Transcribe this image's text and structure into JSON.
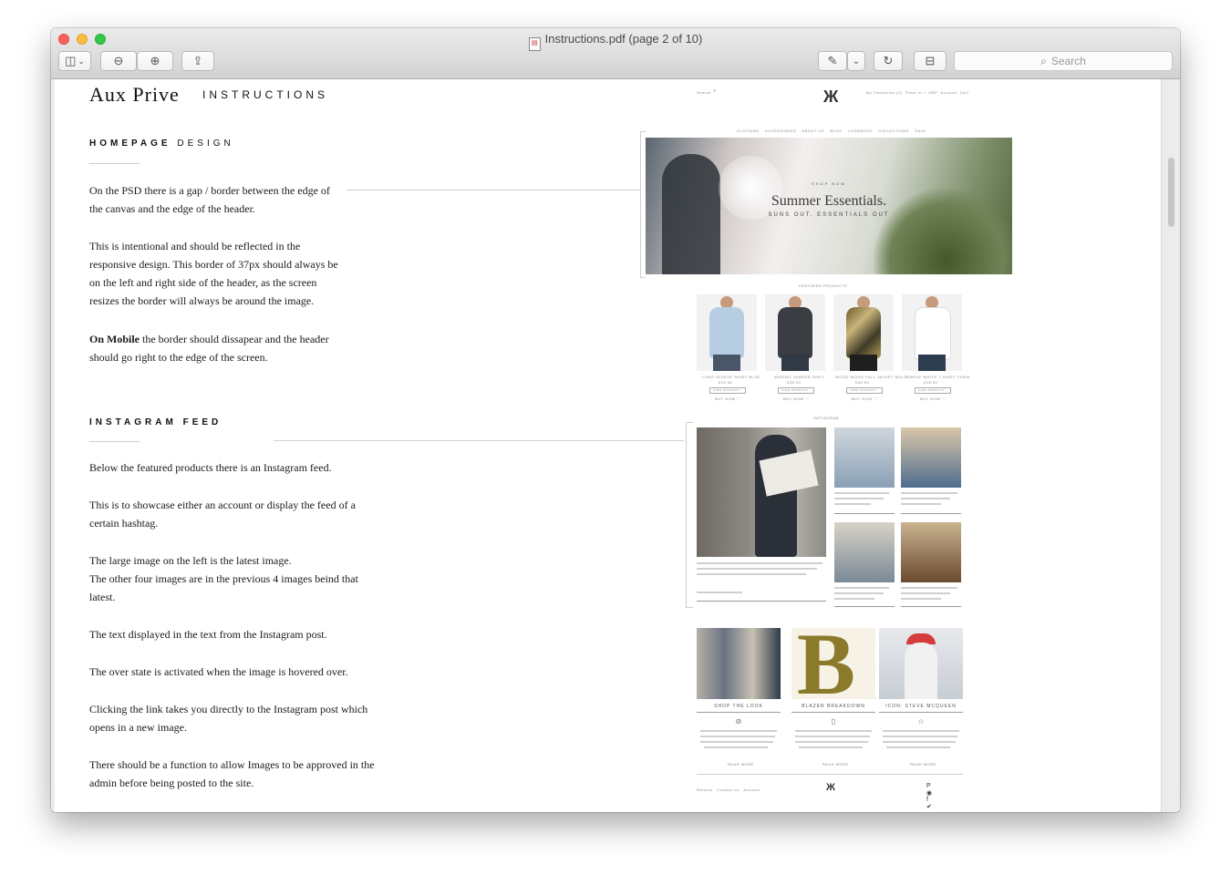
{
  "window": {
    "title": "Instructions.pdf (page 2 of 10)",
    "search_placeholder": "Search"
  },
  "toolbar": {
    "icons": [
      "sidebar-icon",
      "zoom-out-icon",
      "zoom-in-icon",
      "share-icon",
      "markup-icon",
      "rotate-icon",
      "toolbox-icon"
    ]
  },
  "document": {
    "brand": "Aux Prive",
    "header_title": "INSTRUCTIONS",
    "sections": {
      "homepage": {
        "heading_bold": "HOMEPAGE",
        "heading_rest": "DESIGN",
        "p1": "On the PSD there is a gap / border between the edge of the canvas and the edge of the header.",
        "p2": "This is intentional and should be reflected in the responsive design. This border of 37px should always be on the left and right side of the header, as the screen resizes the border will always be around the image.",
        "p3_bold": "On Mobile",
        "p3_rest": " the border should dissapear and the header should go right to the edge of the screen."
      },
      "instagram": {
        "heading": "INSTAGRAM FEED",
        "p1": "Below the featured products there is an Instagram feed.",
        "p2": "This is to showcase either an account or display the feed of a certain hashtag.",
        "p3a": "The large image on the left is the latest image.",
        "p3b": "The other four images are in the previous 4 images beind that latest.",
        "p4": "The text displayed in the text from the Instagram post.",
        "p5": "The over state is activated when the image is hovered over.",
        "p6": "Clicking the link takes you directly to the Instagram post which opens in a new image.",
        "p7": "There should be a function to allow Images to be approved in the admin before being posted to the site."
      }
    }
  },
  "mockup": {
    "nav_left": "Search",
    "nav_right": [
      "My Favourites (1)",
      "Place in ☆ GBP",
      "Account",
      "Cart"
    ],
    "menu": [
      "CLOTHING",
      "ACCESSORIES",
      "ABOUT US",
      "BLOG",
      "LOOKBOOK",
      "COLLECTIONS",
      "SALE"
    ],
    "hero_kicker": "SHOP NOW",
    "hero_title": "Summer Essentials.",
    "hero_sub": "SUNS OUT. ESSENTIALS OUT",
    "featured_heading": "FEATURED PRODUCTS",
    "products": [
      {
        "name": "LONG SLEEVE SHIRT BLUE",
        "price": "£29.00",
        "button": "VIEW PRODUCT",
        "fav": "BUY NOW ♡"
      },
      {
        "name": "MERINO JUMPER GREY",
        "price": "£35.00",
        "button": "VIEW PRODUCT",
        "fav": "BUY NOW ♡"
      },
      {
        "name": "WOOD WOOD FALL JACKET MULTI",
        "price": "£89.00",
        "button": "VIEW PRODUCT",
        "fav": "BUY NOW ♡"
      },
      {
        "name": "SIMPLE WHITE T-SHIRT CREW",
        "price": "£15.00",
        "button": "VIEW PRODUCT",
        "fav": "BUY NOW ♡"
      }
    ],
    "instagram_heading": "INSTAGRAM",
    "blog_posts": [
      {
        "title": "SHOP THE LOOK",
        "icon": "⊘"
      },
      {
        "title": "BLAZER BREAKDOWN",
        "icon": "▯"
      },
      {
        "title": "ICON: STEVE MCQUEEN",
        "icon": "☆"
      }
    ],
    "blog_read_more": "READ MORE",
    "footer_links": [
      "Returns",
      "Contact us",
      "Account"
    ],
    "social": "P ◉ f ✔"
  },
  "colors": {
    "accent": "#111111",
    "rule": "#cfcfcf",
    "hero_foliage": "#55653c"
  }
}
